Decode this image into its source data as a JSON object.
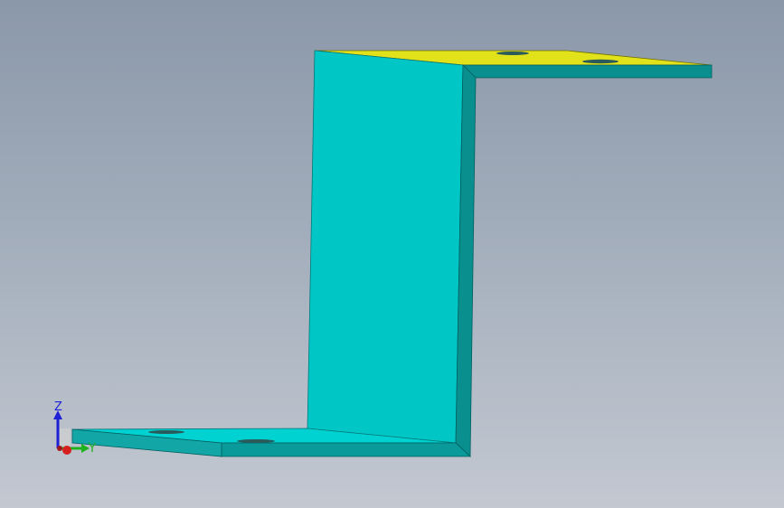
{
  "viewport": {
    "background_top": "#8b98a9",
    "background_bottom": "#c3c8d1"
  },
  "model": {
    "face_color": "#00c4c4",
    "edge_color": "#007a7a",
    "top_face_color": "#e2e21a",
    "hole_color": "#1f4d4d"
  },
  "triad": {
    "z_label": "Z",
    "y_label": "Y",
    "z_color": "#1f1fd6",
    "y_color": "#1fb21f",
    "x_color": "#d61f1f"
  }
}
